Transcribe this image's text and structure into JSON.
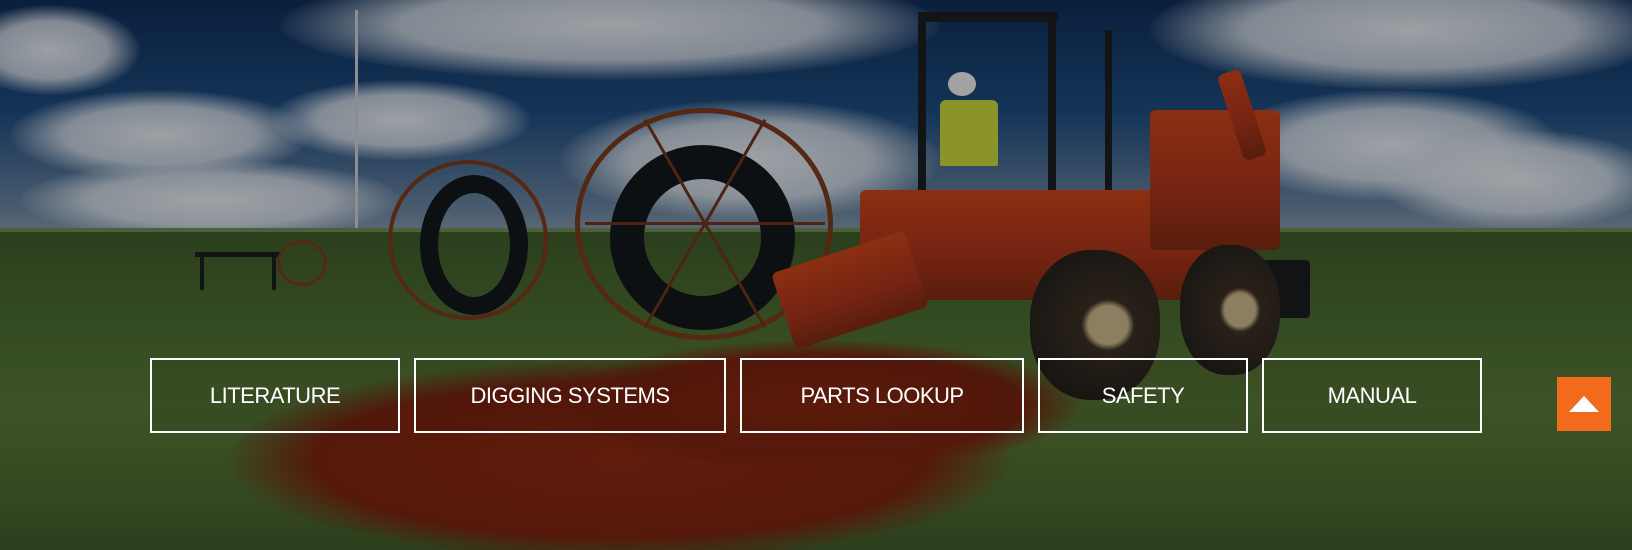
{
  "hero": {
    "nav_buttons": [
      {
        "label": "LITERATURE"
      },
      {
        "label": "DIGGING SYSTEMS"
      },
      {
        "label": "PARTS LOOKUP"
      },
      {
        "label": "SAFETY"
      },
      {
        "label": "MANUAL"
      }
    ],
    "scroll_top_icon": "arrow-up-icon",
    "accent_color": "#f26a1b",
    "button_border_color": "#ffffff"
  }
}
